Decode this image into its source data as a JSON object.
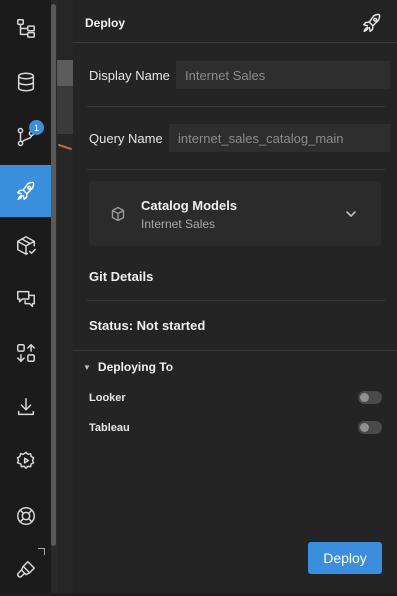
{
  "sidebar": {
    "items": [
      {
        "icon": "hierarchy-icon"
      },
      {
        "icon": "database-icon"
      },
      {
        "icon": "git-branch-icon",
        "badge": "1"
      },
      {
        "icon": "rocket-icon",
        "active": true
      },
      {
        "icon": "package-check-icon"
      },
      {
        "icon": "chat-icon"
      },
      {
        "icon": "compare-icon"
      },
      {
        "icon": "download-icon"
      },
      {
        "icon": "settings-play-icon"
      },
      {
        "icon": "lifebuoy-icon"
      },
      {
        "icon": "brush-icon"
      }
    ]
  },
  "panel": {
    "title": "Deploy",
    "display_name_label": "Display Name",
    "display_name_value": "Internet Sales",
    "query_name_label": "Query Name",
    "query_name_value": "internet_sales_catalog_main",
    "catalog": {
      "title": "Catalog Models",
      "subtitle": "Internet Sales"
    },
    "git_details": "Git Details",
    "status": "Status: Not started",
    "deploying_to": "Deploying To",
    "targets": [
      {
        "label": "Looker",
        "enabled": false
      },
      {
        "label": "Tableau",
        "enabled": false
      }
    ],
    "deploy_button": "Deploy"
  },
  "colors": {
    "accent": "#3b8ede",
    "background": "#242424"
  }
}
